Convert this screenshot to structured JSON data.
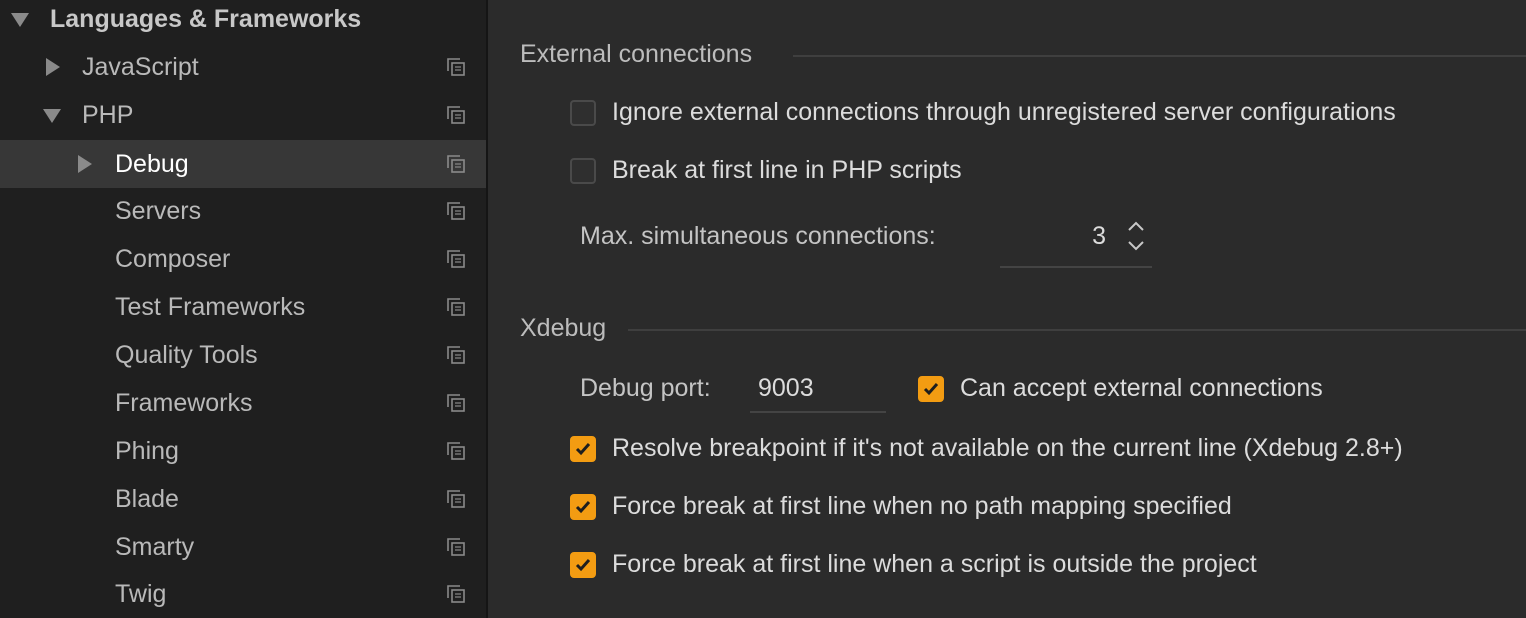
{
  "sidebar": {
    "items": [
      {
        "label": "Languages & Frameworks",
        "arrow": "down"
      },
      {
        "label": "JavaScript",
        "arrow": "right"
      },
      {
        "label": "PHP",
        "arrow": "down"
      },
      {
        "label": "Debug",
        "arrow": "right"
      },
      {
        "label": "Servers"
      },
      {
        "label": "Composer"
      },
      {
        "label": "Test Frameworks"
      },
      {
        "label": "Quality Tools"
      },
      {
        "label": "Frameworks"
      },
      {
        "label": "Phing"
      },
      {
        "label": "Blade"
      },
      {
        "label": "Smarty"
      },
      {
        "label": "Twig"
      }
    ],
    "selected": "Debug"
  },
  "external": {
    "title": "External connections",
    "ignore_label": "Ignore external connections through unregistered server configurations",
    "ignore_checked": false,
    "break_first_label": "Break at first line in PHP scripts",
    "break_first_checked": false,
    "max_label": "Max. simultaneous connections:",
    "max_value": "3"
  },
  "xdebug": {
    "title": "Xdebug",
    "port_label": "Debug port:",
    "port_value": "9003",
    "accept_label": "Can accept external connections",
    "accept_checked": true,
    "resolve_label": "Resolve breakpoint if it's not available on the current line (Xdebug 2.8+)",
    "resolve_checked": true,
    "force_no_mapping_label": "Force break at first line when no path mapping specified",
    "force_no_mapping_checked": true,
    "force_outside_label": "Force break at first line when a script is outside the project",
    "force_outside_checked": true
  },
  "colors": {
    "accent": "#f39c12",
    "sidebar_bg": "#1f1f1f",
    "content_bg": "#2b2b2b",
    "selected_bg": "#373737"
  }
}
